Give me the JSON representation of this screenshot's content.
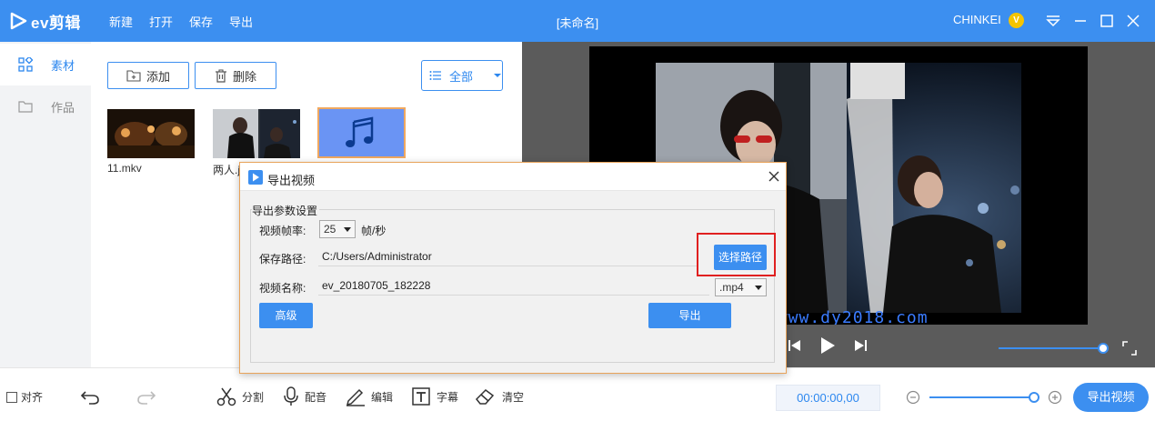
{
  "app": {
    "logo_text": "ev剪辑",
    "menu": [
      "新建",
      "打开",
      "保存",
      "导出"
    ],
    "doc_title": "[未命名]",
    "user": "CHINKEI",
    "vip_badge": "V"
  },
  "sidebar": {
    "items": [
      {
        "label": "素材",
        "active": true
      },
      {
        "label": "作品",
        "active": false
      }
    ]
  },
  "material": {
    "add_label": "添加",
    "delete_label": "删除",
    "filter_value": "全部",
    "thumbs": [
      {
        "label": "11.mkv",
        "kind": "video"
      },
      {
        "label": "两人.j",
        "kind": "image"
      },
      {
        "label": "",
        "kind": "audio"
      }
    ]
  },
  "player": {
    "watermark": "有访问 www.dy2018.com"
  },
  "bottombar": {
    "align_label": "对齐",
    "tools": [
      "分割",
      "配音",
      "编辑",
      "字幕",
      "清空"
    ],
    "timecode": "00:00:00,00",
    "export_label": "导出视频"
  },
  "dialog": {
    "title": "导出视频",
    "group_title": "导出参数设置",
    "fps_label": "视频帧率:",
    "fps_value": "25",
    "fps_unit": "帧/秒",
    "path_label": "保存路径:",
    "path_value": "C:/Users/Administrator",
    "choose_path_label": "选择路径",
    "name_label": "视频名称:",
    "name_value": "ev_20180705_182228",
    "ext_value": ".mp4",
    "advanced_label": "高级",
    "export_label": "导出"
  },
  "colors": {
    "accent": "#3c8ff0",
    "highlight": "#e02020",
    "dialog_border": "#e8a35a"
  }
}
